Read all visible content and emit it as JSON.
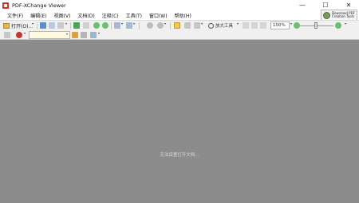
{
  "window": {
    "title": "PDF-XChange Viewer",
    "minimize": "—",
    "maximize": "☐",
    "close": "✕"
  },
  "menu": [
    "文件(F)",
    "编辑(E)",
    "视图(V)",
    "文档(D)",
    "注释(C)",
    "工具(T)",
    "窗口(W)",
    "帮助(H)"
  ],
  "download_promo": {
    "line1": "Download PDF",
    "line2": "Creation Tools"
  },
  "toolbar": {
    "open_label": "打开(O)...",
    "zoom_tool_label": "放大工具",
    "zoom_value": "100%"
  },
  "workspace": {
    "empty_message": "无法设置打开文档..."
  },
  "colors": {
    "workspace_bg": "#8c8c8c",
    "toolbar_bg": "#f0f0f0",
    "accent": "#f2c84b"
  }
}
